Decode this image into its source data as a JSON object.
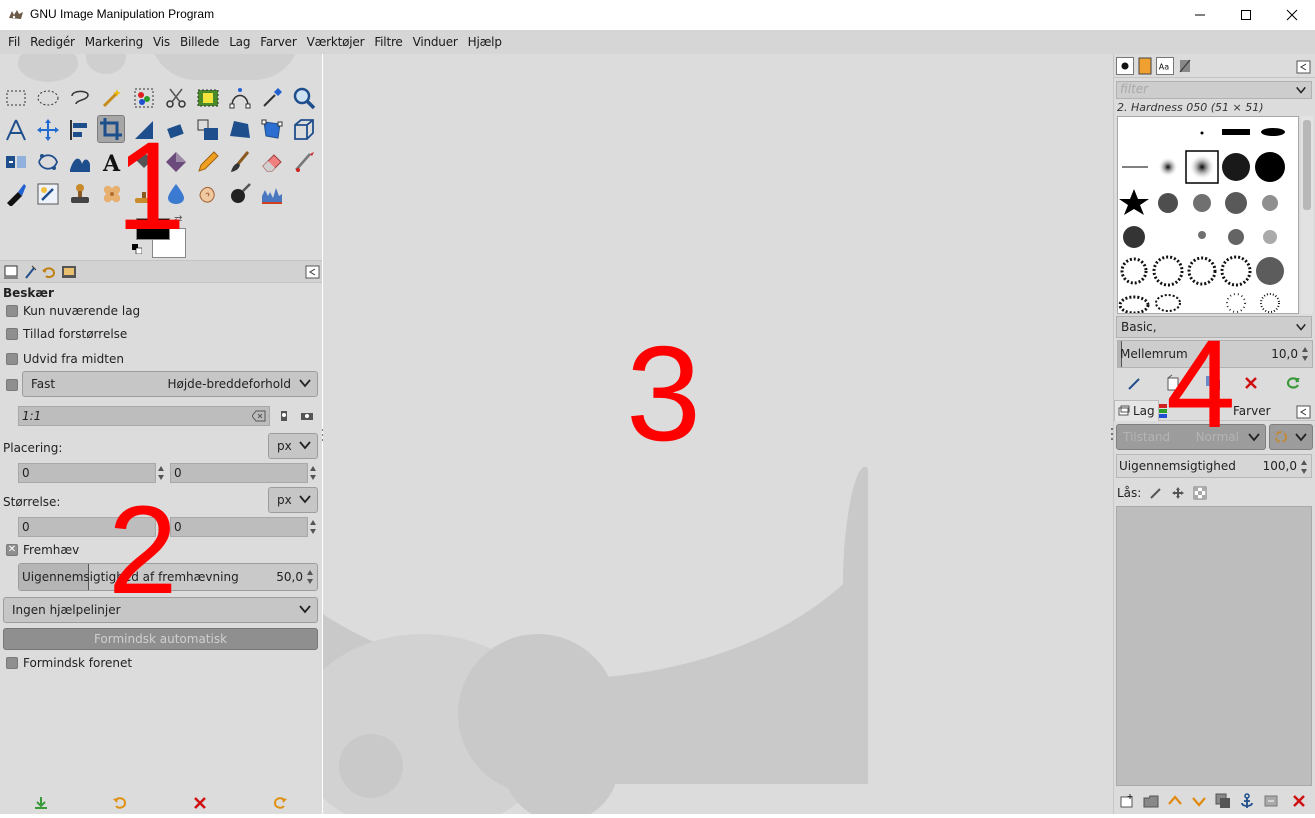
{
  "window": {
    "title": "GNU Image Manipulation Program"
  },
  "menubar": {
    "items": [
      "Fil",
      "Redigér",
      "Markering",
      "Vis",
      "Billede",
      "Lag",
      "Farver",
      "Værktøjer",
      "Filtre",
      "Vinduer",
      "Hjælp"
    ]
  },
  "tool_options": {
    "title": "Beskær",
    "current_layer_only": "Kun nuværende lag",
    "allow_growing": "Tillad forstørrelse",
    "expand_from_center": "Udvid fra midten",
    "fixed_label": "Fast",
    "fixed_mode": "Højde-breddeforhold",
    "ratio_value": "1:1",
    "position_label": "Placering:",
    "position_unit": "px",
    "position_x": "0",
    "position_y": "0",
    "size_label": "Størrelse:",
    "size_unit": "px",
    "size_w": "0",
    "size_h": "0",
    "highlight_label": "Fremhæv",
    "highlight_opacity_label": "Uigennemsigtighed af fremhævning",
    "highlight_opacity_value": "50,0",
    "highlight_opacity": 0.5,
    "guides": "Ingen hjælpelinjer",
    "auto_shrink": "Formindsk automatisk",
    "shrink_merged": "Formindsk forenet"
  },
  "brushes": {
    "filter_placeholder": "filter",
    "selected": "2. Hardness 050 (51 × 51)",
    "set": "Basic,",
    "spacing_label": "Mellemrum",
    "spacing_value": "10,0"
  },
  "layers": {
    "tab_layers": "Lag",
    "tab_colors": "Farver",
    "mode": "Tilstand",
    "mode_value": "Normal",
    "opacity_label": "Uigennemsigtighed",
    "opacity_value": "100,0",
    "lock_label": "Lås:"
  },
  "annotations": [
    "1",
    "2",
    "3",
    "4"
  ],
  "colors": {
    "annotation": "#ff0000",
    "panel": "#dcdcdc",
    "menubar": "#d6d6d6"
  }
}
